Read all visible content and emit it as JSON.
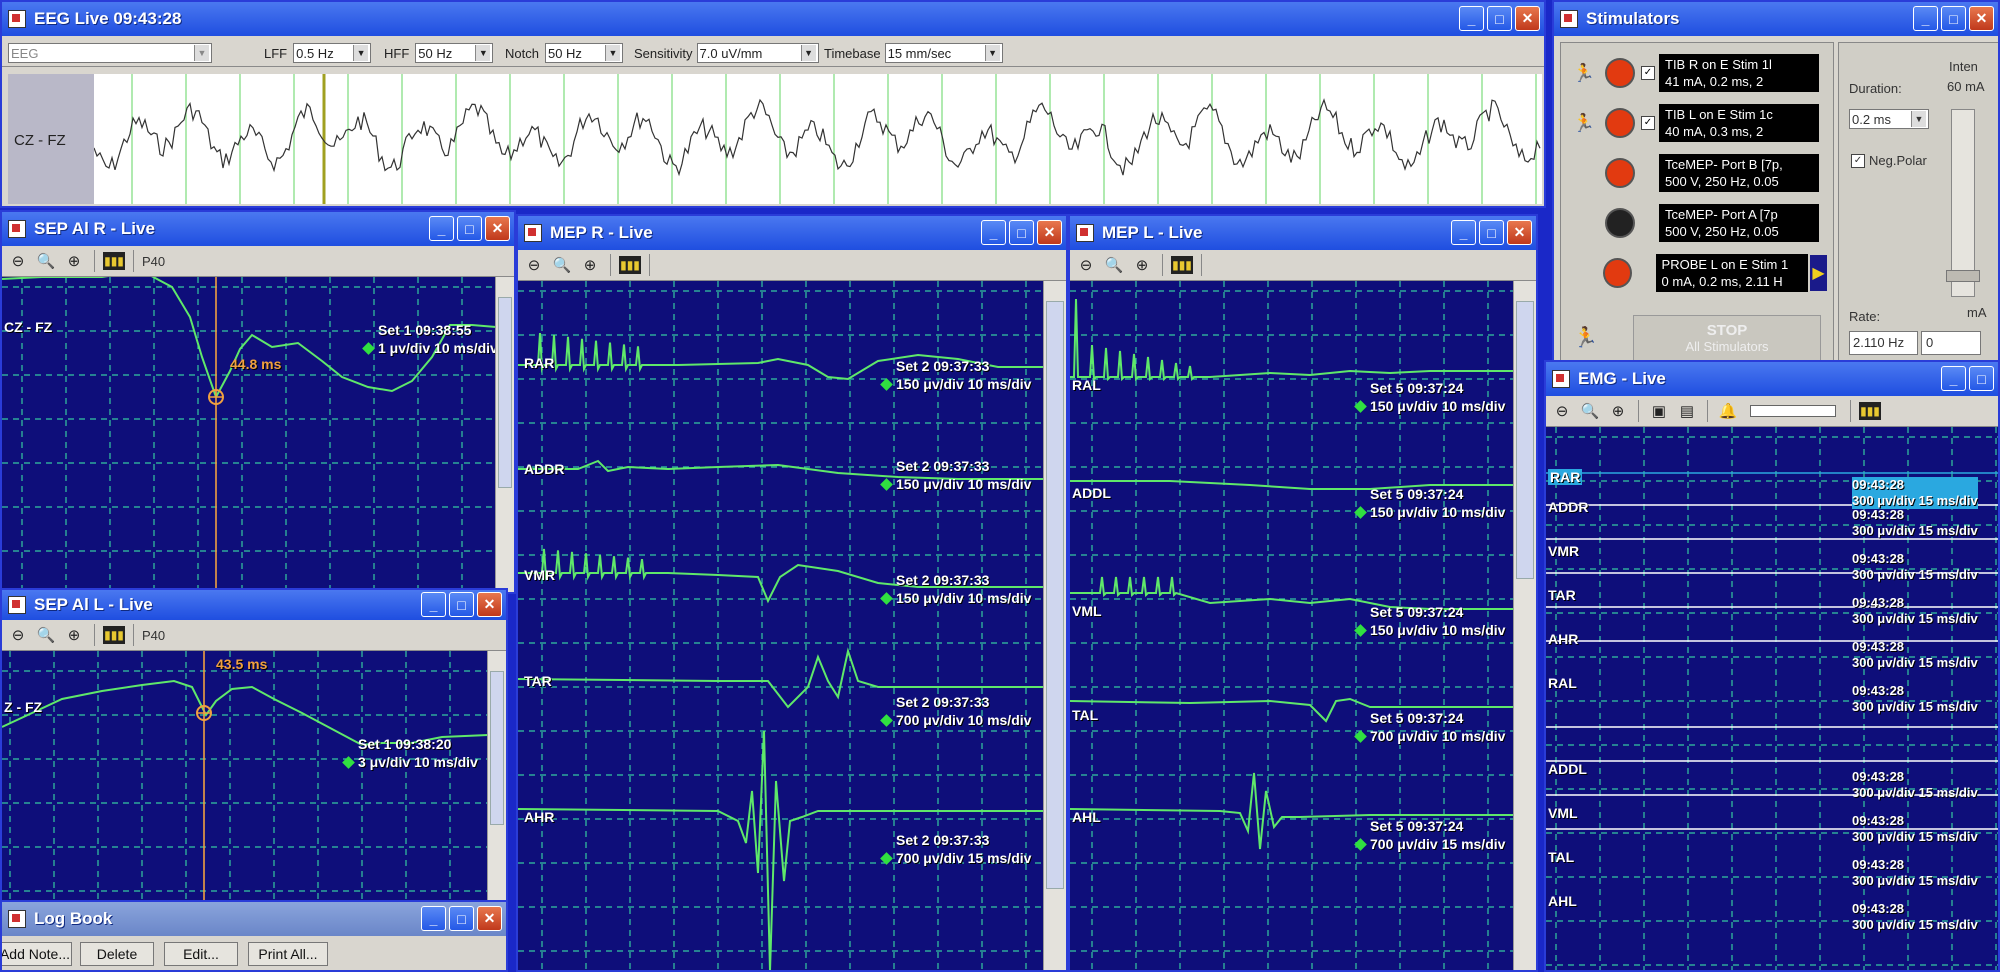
{
  "eeg": {
    "title": "EEG Live 09:43:28",
    "montage": "EEG",
    "lff_label": "LFF",
    "lff": "0.5 Hz",
    "hff_label": "HFF",
    "hff": "50 Hz",
    "notch_label": "Notch",
    "notch": "50 Hz",
    "sensitivity_label": "Sensitivity",
    "sensitivity": "7.0 uV/mm",
    "timebase_label": "Timebase",
    "timebase": "15 mm/sec",
    "channel": "CZ - FZ"
  },
  "sep_r": {
    "title": "SEP Al R - Live",
    "tool_label": "P40",
    "channel": "CZ - FZ",
    "latency": "44.8 ms",
    "set": "Set 1 09:38:55",
    "scale": "1 μv/div 10 ms/div"
  },
  "sep_l": {
    "title": "SEP Al L - Live",
    "tool_label": "P40",
    "channel": "Z - FZ",
    "latency": "43.5 ms",
    "set": "Set 1 09:38:20",
    "scale": "3 μv/div 10 ms/div"
  },
  "mep_r": {
    "title": "MEP R - Live",
    "channels": [
      {
        "name": "RAR",
        "set": "Set 2 09:37:33",
        "scale": "150 μv/div 10 ms/div"
      },
      {
        "name": "ADDR",
        "set": "Set 2 09:37:33",
        "scale": "150 μv/div 10 ms/div"
      },
      {
        "name": "VMR",
        "set": "Set 2 09:37:33",
        "scale": "150 μv/div 10 ms/div"
      },
      {
        "name": "TAR",
        "set": "Set 2 09:37:33",
        "scale": "700 μv/div 10 ms/div"
      },
      {
        "name": "AHR",
        "set": "Set 2 09:37:33",
        "scale": "700 μv/div 15 ms/div"
      }
    ]
  },
  "mep_l": {
    "title": "MEP L - Live",
    "channels": [
      {
        "name": "RAL",
        "set": "Set 5 09:37:24",
        "scale": "150 μv/div 10 ms/div"
      },
      {
        "name": "ADDL",
        "set": "Set 5 09:37:24",
        "scale": "150 μv/div 10 ms/div"
      },
      {
        "name": "VML",
        "set": "Set 5 09:37:24",
        "scale": "150 μv/div 10 ms/div"
      },
      {
        "name": "TAL",
        "set": "Set 5 09:37:24",
        "scale": "700 μv/div 10 ms/div"
      },
      {
        "name": "AHL",
        "set": "Set 5 09:37:24",
        "scale": "700 μv/div 15 ms/div"
      }
    ]
  },
  "stim": {
    "title": "Stimulators",
    "rows": [
      {
        "line1": "TIB R on E Stim 1l",
        "line2": "41 mA, 0.2 ms, 2",
        "on": true
      },
      {
        "line1": "TIB L on E Stim 1c",
        "line2": "40 mA, 0.3 ms, 2",
        "on": true
      },
      {
        "line1": "TceMEP- Port B  [7p,",
        "line2": "500 V, 250 Hz, 0.05",
        "on": true
      },
      {
        "line1": "TceMEP- Port A  [7p",
        "line2": "500 V, 250 Hz, 0.05",
        "on": false
      },
      {
        "line1": "PROBE L on E Stim 1",
        "line2": "0 mA, 0.2 ms, 2.11 H",
        "on": true
      }
    ],
    "stop_label": "STOP",
    "stop_sub": "All Stimulators",
    "inten_label": "Inten",
    "inten_value": "60 mA",
    "duration_label": "Duration:",
    "duration": "0.2 ms",
    "neg_polar": "Neg.Polar",
    "rate_label": "Rate:",
    "rate": "2.110 Hz",
    "ma_unit": "mA",
    "zero": "0"
  },
  "emg": {
    "title": "EMG  - Live",
    "channels": [
      {
        "name": "RAR",
        "time": "09:43:28",
        "scale": "300 μv/div 15 ms/div"
      },
      {
        "name": "ADDR",
        "time": "09:43:28",
        "scale": "300 μv/div 15 ms/div"
      },
      {
        "name": "VMR",
        "time": "09:43:28",
        "scale": "300 μv/div 15 ms/div"
      },
      {
        "name": "TAR",
        "time": "09:43:28",
        "scale": "300 μv/div 15 ms/div"
      },
      {
        "name": "AHR",
        "time": "09:43:28",
        "scale": "300 μv/div 15 ms/div"
      },
      {
        "name": "RAL",
        "time": "09:43:28",
        "scale": "300 μv/div 15 ms/div"
      },
      {
        "name": "ADDL",
        "time": "09:43:28",
        "scale": "300 μv/div 15 ms/div"
      },
      {
        "name": "VML",
        "time": "09:43:28",
        "scale": "300 μv/div 15 ms/div"
      },
      {
        "name": "TAL",
        "time": "09:43:28",
        "scale": "300 μv/div 15 ms/div"
      },
      {
        "name": "AHL",
        "time": "09:43:28",
        "scale": "300 μv/div 15 ms/div"
      }
    ]
  },
  "log": {
    "title": "Log Book",
    "add": "Add Note...",
    "delete": "Delete",
    "edit": "Edit...",
    "print": "Print All..."
  },
  "colors": {
    "trace": "#5fe86a",
    "plot_bg": "#0e0e7a",
    "grid": "#35c8a0",
    "cursor": "#f0a040"
  }
}
